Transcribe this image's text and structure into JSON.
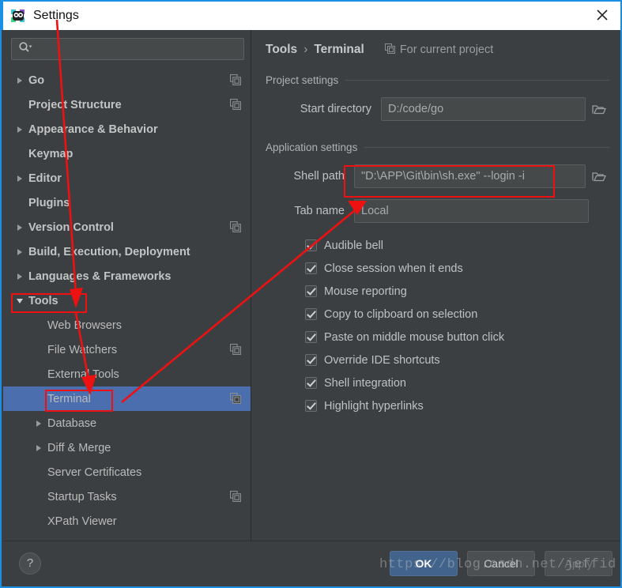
{
  "window": {
    "title": "Settings",
    "icon": "goland-icon",
    "close_label": "close-icon"
  },
  "sidebar": {
    "search": {
      "placeholder": "",
      "value": "",
      "icon": "search-icon"
    },
    "items": [
      {
        "label": "Go",
        "expandable": true,
        "expanded": false,
        "bold": true,
        "indent": 1,
        "copy": true
      },
      {
        "label": "Project Structure",
        "expandable": false,
        "expanded": false,
        "bold": true,
        "indent": 1,
        "copy": true
      },
      {
        "label": "Appearance & Behavior",
        "expandable": true,
        "expanded": false,
        "bold": true,
        "indent": 1,
        "copy": false
      },
      {
        "label": "Keymap",
        "expandable": false,
        "expanded": false,
        "bold": true,
        "indent": 1,
        "copy": false
      },
      {
        "label": "Editor",
        "expandable": true,
        "expanded": false,
        "bold": true,
        "indent": 1,
        "copy": false
      },
      {
        "label": "Plugins",
        "expandable": false,
        "expanded": false,
        "bold": true,
        "indent": 1,
        "copy": false
      },
      {
        "label": "Version Control",
        "expandable": true,
        "expanded": false,
        "bold": true,
        "indent": 1,
        "copy": true
      },
      {
        "label": "Build, Execution, Deployment",
        "expandable": true,
        "expanded": false,
        "bold": true,
        "indent": 1,
        "copy": false
      },
      {
        "label": "Languages & Frameworks",
        "expandable": true,
        "expanded": false,
        "bold": true,
        "indent": 1,
        "copy": false
      },
      {
        "label": "Tools",
        "expandable": true,
        "expanded": true,
        "bold": true,
        "indent": 1,
        "copy": false
      },
      {
        "label": "Web Browsers",
        "expandable": false,
        "expanded": false,
        "bold": false,
        "indent": 2,
        "copy": false
      },
      {
        "label": "File Watchers",
        "expandable": false,
        "expanded": false,
        "bold": false,
        "indent": 2,
        "copy": true
      },
      {
        "label": "External Tools",
        "expandable": false,
        "expanded": false,
        "bold": false,
        "indent": 2,
        "copy": false
      },
      {
        "label": "Terminal",
        "expandable": false,
        "expanded": false,
        "bold": false,
        "indent": 2,
        "copy": true,
        "selected": true
      },
      {
        "label": "Database",
        "expandable": true,
        "expanded": false,
        "bold": false,
        "indent": 2,
        "copy": false
      },
      {
        "label": "Diff & Merge",
        "expandable": true,
        "expanded": false,
        "bold": false,
        "indent": 2,
        "copy": false
      },
      {
        "label": "Server Certificates",
        "expandable": false,
        "expanded": false,
        "bold": false,
        "indent": 2,
        "copy": false
      },
      {
        "label": "Startup Tasks",
        "expandable": false,
        "expanded": false,
        "bold": false,
        "indent": 2,
        "copy": true
      },
      {
        "label": "XPath Viewer",
        "expandable": false,
        "expanded": false,
        "bold": false,
        "indent": 2,
        "copy": false
      }
    ]
  },
  "content": {
    "breadcrumb": {
      "root": "Tools",
      "separator": "›",
      "leaf": "Terminal"
    },
    "for_current_project": "For current project",
    "project_settings": {
      "title": "Project settings",
      "start_directory_label": "Start directory",
      "start_directory_value": "D:/code/go",
      "browse_icon": "folder-icon"
    },
    "application_settings": {
      "title": "Application settings",
      "shell_path_label": "Shell path",
      "shell_path_value": "\"D:\\APP\\Git\\bin\\sh.exe\" --login -i",
      "tab_name_label": "Tab name",
      "tab_name_value": "Local",
      "browse_icon": "folder-icon",
      "checkboxes": [
        {
          "label": "Audible bell",
          "checked": true
        },
        {
          "label": "Close session when it ends",
          "checked": true
        },
        {
          "label": "Mouse reporting",
          "checked": true
        },
        {
          "label": "Copy to clipboard on selection",
          "checked": true
        },
        {
          "label": "Paste on middle mouse button click",
          "checked": true
        },
        {
          "label": "Override IDE shortcuts",
          "checked": true
        },
        {
          "label": "Shell integration",
          "checked": true
        },
        {
          "label": "Highlight hyperlinks",
          "checked": true
        }
      ]
    }
  },
  "footer": {
    "help_label": "?",
    "ok_label": "OK",
    "cancel_label": "Cancel",
    "apply_label": "Apply",
    "apply_disabled": true
  },
  "watermark": "https://blog.csdn.net/jeffid",
  "colors": {
    "accent_blue": "#1a8fe3",
    "selection_blue": "#4b6eaf",
    "annotation_red": "#ee1111",
    "panel_bg": "#3c3f41",
    "field_bg": "#45494a",
    "primary_button": "#41638c"
  }
}
